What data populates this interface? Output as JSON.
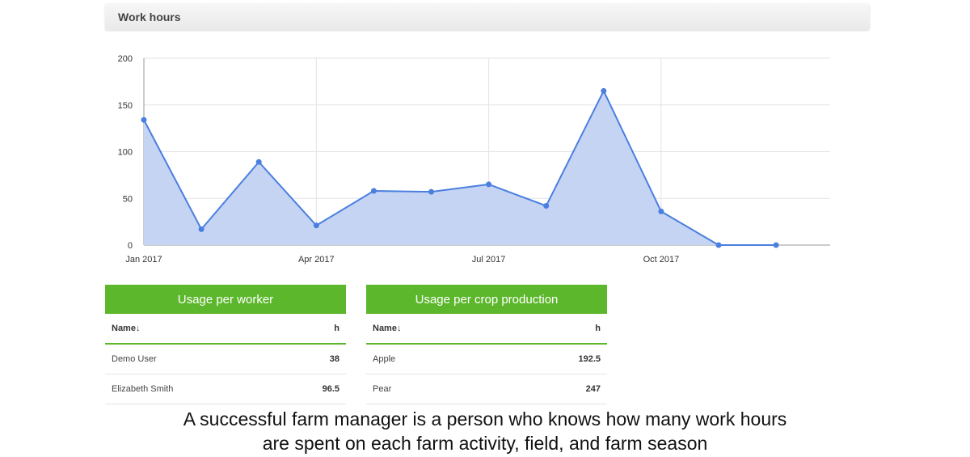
{
  "panel": {
    "title": "Work hours"
  },
  "chart_data": {
    "type": "area",
    "ylim": [
      0,
      200
    ],
    "yticks": [
      "200",
      "150",
      "100",
      "50",
      "0"
    ],
    "xtick_labels": [
      "Jan 2017",
      "Apr 2017",
      "Jul 2017",
      "Oct 2017"
    ],
    "x": [
      "Jan 2017",
      "Feb 2017",
      "Mar 2017",
      "Apr 2017",
      "May 2017",
      "Jun 2017",
      "Jul 2017",
      "Aug 2017",
      "Sep 2017",
      "Oct 2017",
      "Nov 2017",
      "Dec 2017"
    ],
    "values": [
      134,
      17,
      89,
      21,
      58,
      57,
      65,
      42,
      165,
      36,
      0,
      0
    ],
    "grid": true,
    "colors": {
      "line": "#4a7fe0",
      "fill": "#c5d4f2"
    }
  },
  "tables": [
    {
      "header": "Usage per worker",
      "col_name": "Name↓",
      "col_value": "h",
      "rows": [
        {
          "name": "Demo User",
          "value": "38"
        },
        {
          "name": "Elizabeth Smith",
          "value": "96.5"
        }
      ]
    },
    {
      "header": "Usage per crop production",
      "col_name": "Name↓",
      "col_value": "h",
      "rows": [
        {
          "name": "Apple",
          "value": "192.5"
        },
        {
          "name": "Pear",
          "value": "247"
        }
      ]
    }
  ],
  "caption": {
    "line1": "A successful farm manager is a person who knows how many work hours",
    "line2": "are spent on each farm activity, field, and farm season"
  }
}
